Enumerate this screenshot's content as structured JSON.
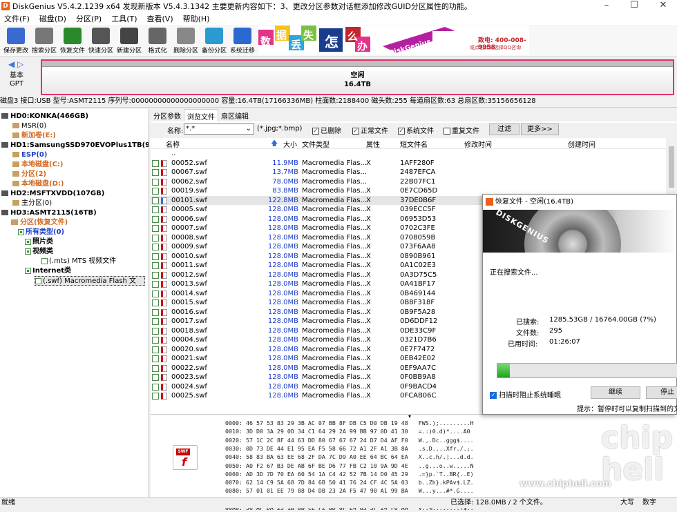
{
  "title": {
    "text": "DiskGenius V5.4.2.1239 x64    发现新版本 V5.4.3.1342   主要更新内容如下：3、更改分区参数对话框添加修改GUID分区属性的功能。"
  },
  "menu": [
    "文件(F)",
    "磁盘(D)",
    "分区(P)",
    "工具(T)",
    "查看(V)",
    "帮助(H)"
  ],
  "toolbar": [
    "保存更改",
    "搜索分区",
    "恢复文件",
    "快速分区",
    "新建分区",
    "格式化",
    "删除分区",
    "备份分区",
    "系统迁移"
  ],
  "banner": {
    "chars": [
      "数",
      "据",
      "丢",
      "失",
      "怎",
      "么",
      "办"
    ],
    "slogan": "DiskGenius 团队为您服务",
    "phone": "致电: 400-008-9958",
    "qq": "或点击此处选择QQ咨询"
  },
  "disk": {
    "kind": "基本",
    "style": "GPT",
    "part_name": "空闲",
    "part_size": "16.4TB"
  },
  "infobar": "磁盘3 接口:USB  型号:ASMT2115  序列号:00000000000000000000  容量:16.4TB(17166336MB)  柱面数:2188400  磁头数:255  每道扇区数:63  总扇区数:35156656128",
  "tree": [
    {
      "t": "HD0:KONKA(466GB)",
      "c": "b"
    },
    {
      "t": "MSR(0)",
      "c": "ind"
    },
    {
      "t": "新加卷(E:)",
      "c": "orange"
    },
    {
      "t": "HD1:SamsungSSD970EVOPlus1TB(932G",
      "c": "b"
    },
    {
      "t": "ESP(0)",
      "c": "blue"
    },
    {
      "t": "本地磁盘(C:)",
      "c": "orange"
    },
    {
      "t": "分区(2)",
      "c": "orange"
    },
    {
      "t": "本地磁盘(D:)",
      "c": "orange"
    },
    {
      "t": "HD2:MSFTXVDD(107GB)",
      "c": "b"
    },
    {
      "t": "主分区(0)",
      "c": ""
    },
    {
      "t": "HD3:ASMT2115(16TB)",
      "c": "b"
    },
    {
      "t": "分区(恢复文件)",
      "c": "orange"
    },
    {
      "t": "所有类型(0)",
      "c": "blue"
    },
    {
      "t": "照片类",
      "c": "b"
    },
    {
      "t": "视频类",
      "c": "b"
    },
    {
      "t": "(.mts) MTS 视频文件",
      "c": ""
    },
    {
      "t": "Internet类",
      "c": "b"
    },
    {
      "t": "(.swf) Macromedia Flash 文",
      "c": "sel"
    }
  ],
  "tabs": [
    "分区参数",
    "浏览文件",
    "扇区编辑"
  ],
  "filter": {
    "name_label": "名称:",
    "name_value": "*.*",
    "ext": "(*.jpg;*.bmp)",
    "deleted": "已删除",
    "normal": "正常文件",
    "system": "系统文件",
    "duplicate": "重复文件",
    "btn_filter": "过滤",
    "btn_more": "更多>>"
  },
  "columns": {
    "name": "名称",
    "size": "大小",
    "type": "文件类型",
    "attr": "属性",
    "short": "短文件名",
    "mtime": "修改时间",
    "ctime": "创建时间"
  },
  "files": [
    {
      "n": "..",
      "s": "",
      "t": "",
      "a": "",
      "sn": ""
    },
    {
      "n": "00052.swf",
      "s": "11.9MB",
      "t": "Macromedia Flas...",
      "a": "X",
      "sn": "1AFF280F"
    },
    {
      "n": "00067.swf",
      "s": "13.7MB",
      "t": "Macromedia Flas...",
      "a": "",
      "sn": "2487EFCA"
    },
    {
      "n": "00062.swf",
      "s": "78.0MB",
      "t": "Macromedia Flas...",
      "a": "",
      "sn": "22B07FC1"
    },
    {
      "n": "00019.swf",
      "s": "83.8MB",
      "t": "Macromedia Flas...",
      "a": "X",
      "sn": "0E7CD65D"
    },
    {
      "n": "00101.swf",
      "s": "122.8MB",
      "t": "Macromedia Flas...",
      "a": "X",
      "sn": "37DE0B6F"
    },
    {
      "n": "00005.swf",
      "s": "128.0MB",
      "t": "Macromedia Flas...",
      "a": "X",
      "sn": "039ECC5F"
    },
    {
      "n": "00006.swf",
      "s": "128.0MB",
      "t": "Macromedia Flas...",
      "a": "X",
      "sn": "06953D53"
    },
    {
      "n": "00007.swf",
      "s": "128.0MB",
      "t": "Macromedia Flas...",
      "a": "X",
      "sn": "0702C3FE"
    },
    {
      "n": "00008.swf",
      "s": "128.0MB",
      "t": "Macromedia Flas...",
      "a": "X",
      "sn": "0708059B"
    },
    {
      "n": "00009.swf",
      "s": "128.0MB",
      "t": "Macromedia Flas...",
      "a": "X",
      "sn": "073F6AA8"
    },
    {
      "n": "00010.swf",
      "s": "128.0MB",
      "t": "Macromedia Flas...",
      "a": "X",
      "sn": "0890B961"
    },
    {
      "n": "00011.swf",
      "s": "128.0MB",
      "t": "Macromedia Flas...",
      "a": "X",
      "sn": "0A1C02E3"
    },
    {
      "n": "00012.swf",
      "s": "128.0MB",
      "t": "Macromedia Flas...",
      "a": "X",
      "sn": "0A3D75C5"
    },
    {
      "n": "00013.swf",
      "s": "128.0MB",
      "t": "Macromedia Flas...",
      "a": "X",
      "sn": "0A41BF17"
    },
    {
      "n": "00014.swf",
      "s": "128.0MB",
      "t": "Macromedia Flas...",
      "a": "X",
      "sn": "0B469144"
    },
    {
      "n": "00015.swf",
      "s": "128.0MB",
      "t": "Macromedia Flas...",
      "a": "X",
      "sn": "0B8F318F"
    },
    {
      "n": "00016.swf",
      "s": "128.0MB",
      "t": "Macromedia Flas...",
      "a": "X",
      "sn": "0B9F5A28"
    },
    {
      "n": "00017.swf",
      "s": "128.0MB",
      "t": "Macromedia Flas...",
      "a": "X",
      "sn": "0D6DDF12"
    },
    {
      "n": "00018.swf",
      "s": "128.0MB",
      "t": "Macromedia Flas...",
      "a": "X",
      "sn": "0DE33C9F"
    },
    {
      "n": "00004.swf",
      "s": "128.0MB",
      "t": "Macromedia Flas...",
      "a": "X",
      "sn": "0321D7B6"
    },
    {
      "n": "00020.swf",
      "s": "128.0MB",
      "t": "Macromedia Flas...",
      "a": "X",
      "sn": "0E7F7472"
    },
    {
      "n": "00021.swf",
      "s": "128.0MB",
      "t": "Macromedia Flas...",
      "a": "X",
      "sn": "0EB42E02"
    },
    {
      "n": "00022.swf",
      "s": "128.0MB",
      "t": "Macromedia Flas...",
      "a": "X",
      "sn": "0EF9AA7C"
    },
    {
      "n": "00023.swf",
      "s": "128.0MB",
      "t": "Macromedia Flas...",
      "a": "X",
      "sn": "0F0BB9A8"
    },
    {
      "n": "00024.swf",
      "s": "128.0MB",
      "t": "Macromedia Flas...",
      "a": "X",
      "sn": "0F9BACD4"
    },
    {
      "n": "00025.swf",
      "s": "128.0MB",
      "t": "Macromedia Flas...",
      "a": "X",
      "sn": "0FCAB06C"
    }
  ],
  "hex": [
    "0000: 46 57 53 83 29 3B AC 07 BB 8F DB C5 D0 DB 19 48   FWS.);.........H",
    "0010: 3D D0 3A 29 0D 34 C1 64 29 2A 99 BB 97 0D 41 30   =.:)0.d)*....A0",
    "0020: 57 1C 2C 8F 44 63 DD 80 67 67 67 24 D7 D4 AF F0   W.,.Dc..ggg$....",
    "0030: 0D 73 DE 44 E1 95 EA F5 58 66 72 A1 2F A1 3B 8A   .s.D....Xfr./.;.",
    "0040: 58 83 BA 63 EE 68 2F DA 7C D9 A0 EE 64 BC 64 EA   X..c.h/.|...d.d.",
    "0050: A0 F2 67 B3 DE AB 6F BE D6 77 FB C2 10 9A 9D 4E   ..g...o..w.....N",
    "0060: AD 3D 7D 70 EA 60 54 1A C4 42 52 7B 14 D0 45 29   .=}p.`T..BR{..E)",
    "0070: 62 14 C9 5A 68 7D 84 6B 50 41 76 24 CF 4C 5A 03   b..Zh}.kPAv$.LZ.",
    "0080: 57 01 01 EE 79 88 D4 DB 23 2A F5 47 90 A1 99 BA   W...y...#*.G....",
    "0090: C4 9B E2 4E 18 F5 88 8A 1A CC 2B F2 09 6C 8A C7   ...N......+..l..",
    "00A0: 56 AF DA 25 1B 8B CE F2 BD 0F E4 83 3F 24 F0 AA   V..%........?$.."
  ],
  "status": {
    "left": "就绪",
    "sel": "已选择: 128.0MB / 2 个文件。",
    "caps": "大写",
    "num": "数字"
  },
  "dialog": {
    "title": "恢复文件 - 空闲(16.4TB)",
    "brand": "DISKGENIUS",
    "state": "正在搜索文件...",
    "searched_label": "已搜索:",
    "searched": "1285.53GB / 16764.00GB (7%)",
    "files_label": "文件数:",
    "files": "295",
    "time_label": "已用时间:",
    "time": "01:26:07",
    "progress": 0.07,
    "prevent_sleep": "扫描时阻止系统睡眠",
    "btn_continue": "继续",
    "btn_stop": "停止",
    "hint": "提示：暂停时可以复制扫描到的文"
  },
  "watermark": {
    "logo": "chip hell",
    "url": "www.chiphell.com"
  }
}
